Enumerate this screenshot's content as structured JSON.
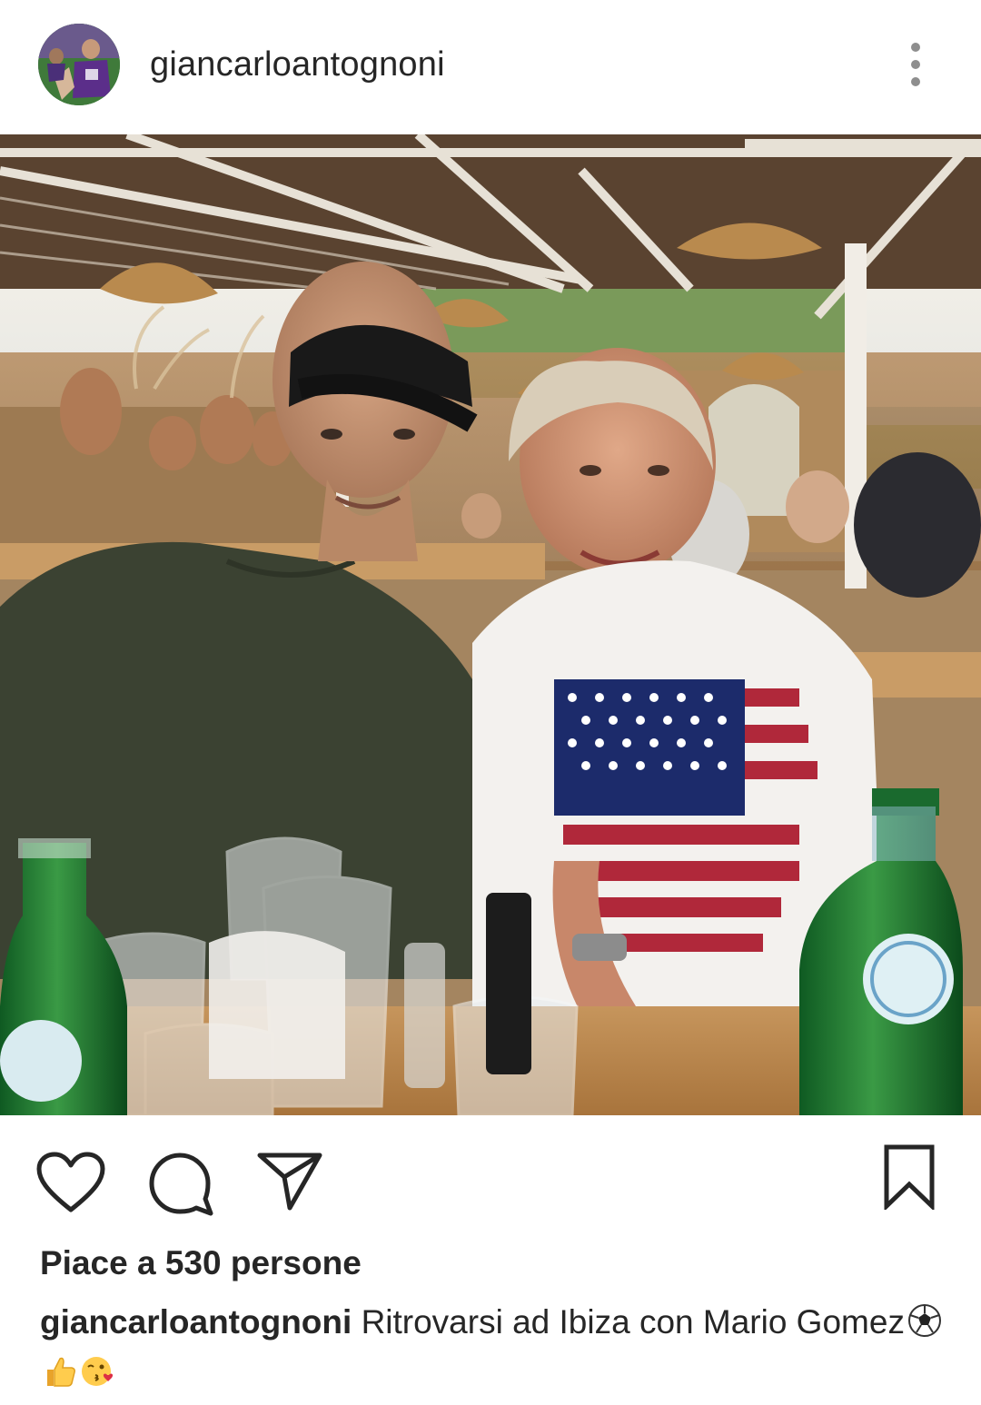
{
  "post": {
    "username": "giancarloantognoni",
    "likes_text": "Piace a 530 persone",
    "caption_user": "giancarloantognoni",
    "caption_text": "Ritrovarsi ad Ibiza con Mario Gomez",
    "caption_emojis": [
      "soccer-ball-emoji",
      "thumbs-up-emoji",
      "face-blowing-kiss-emoji"
    ]
  },
  "icons": {
    "more": "more-vertical-icon",
    "like": "heart-icon",
    "comment": "comment-icon",
    "share": "send-icon",
    "save": "bookmark-icon"
  },
  "colors": {
    "text": "#262626",
    "background": "#ffffff"
  }
}
